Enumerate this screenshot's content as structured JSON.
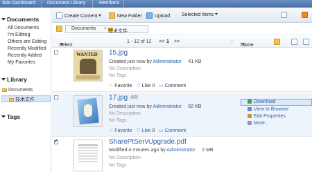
{
  "topbar": {
    "site_dashboard": "Site Dashboard",
    "document_library": "Document Library",
    "members": "Members"
  },
  "sidebar": {
    "documents_header": "Documents",
    "items": [
      "All Documents",
      "I'm Editing",
      "Others are Editing",
      "Recently Modified",
      "Recently Added",
      "My Favorites"
    ],
    "library_header": "Library",
    "library_root": "Documents",
    "library_folder": "技术文件",
    "tags_header": "Tags"
  },
  "toolbar": {
    "create": "Create Content",
    "new_folder": "New Folder",
    "upload": "Upload",
    "selected": "Selected Items"
  },
  "breadcrumb": {
    "root": "Documents",
    "folder": "技术文件"
  },
  "pager": {
    "select": "Select",
    "range": "1 - 12 of 12",
    "prev": "<<",
    "page": "1",
    "next": ">>",
    "sort": "Name"
  },
  "documents": [
    {
      "name": "15.jpg",
      "meta_prefix": "Created just now by",
      "author": "Administrator",
      "size": "41 KB",
      "desc": "No Description",
      "tags": "No Tags",
      "favorite": "Favorite",
      "like": "Like",
      "like_count": "0",
      "comment": "Comment",
      "version": ""
    },
    {
      "name": "17.jpg",
      "meta_prefix": "Created just now by",
      "author": "Administrator",
      "size": "62 KB",
      "desc": "No Description",
      "tags": "No Tags",
      "favorite": "Favorite",
      "like": "Like",
      "like_count": "0",
      "comment": "Comment",
      "version": "1.0"
    },
    {
      "name": "SharePtServUpgrade.pdf",
      "meta_prefix": "Modified 4 minutes ago by",
      "author": "Administrator",
      "size": "2 MB",
      "desc": "No Description",
      "tags": "No Tags",
      "favorite": "",
      "like": "",
      "like_count": "",
      "comment": "",
      "version": ""
    }
  ],
  "thumb1": {
    "poster": "WANTED"
  },
  "actions_menu": [
    "Download",
    "View In Browser",
    "Edit Properties",
    "More..."
  ],
  "colors": {
    "accent": "#2a5fa8",
    "topbar": "#5a80b8",
    "folder": "#f3c14a"
  }
}
